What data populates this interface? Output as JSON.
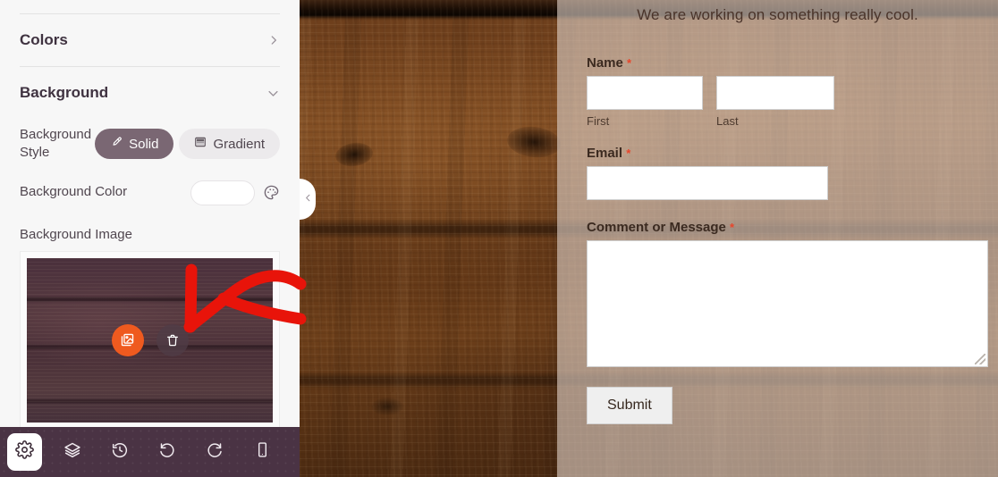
{
  "sidebar": {
    "sections": [
      {
        "title": "Colors",
        "chevron_icon": "chevron-right-icon",
        "expanded": false
      },
      {
        "title": "Background",
        "chevron_icon": "chevron-down-icon",
        "expanded": true
      }
    ],
    "background_style": {
      "label": "Background Style",
      "options": [
        {
          "label": "Solid",
          "icon": "eyedropper-icon",
          "active": true
        },
        {
          "label": "Gradient",
          "icon": "gradient-grid-icon",
          "active": false
        }
      ]
    },
    "background_color": {
      "label": "Background Color",
      "value": "#ffffff",
      "picker_icon": "palette-icon"
    },
    "background_image": {
      "label": "Background Image",
      "replace_icon": "image-swap-icon",
      "delete_icon": "trash-icon"
    },
    "collapse_handle_icon": "chevron-left-icon"
  },
  "toolbar": {
    "items": [
      {
        "name": "settings",
        "icon": "gear-icon",
        "active": true
      },
      {
        "name": "layers",
        "icon": "layers-icon",
        "active": false
      },
      {
        "name": "revisions",
        "icon": "history-clock-icon",
        "active": false
      },
      {
        "name": "undo",
        "icon": "undo-icon",
        "active": false
      },
      {
        "name": "redo",
        "icon": "redo-icon",
        "active": false
      },
      {
        "name": "mobile-preview",
        "icon": "mobile-device-icon",
        "active": false
      }
    ]
  },
  "preview": {
    "heading": "We are working on something really cool.",
    "fields": {
      "name": {
        "label": "Name",
        "required_marker": "*",
        "first": {
          "value": "",
          "sub_label": "First"
        },
        "last": {
          "value": "",
          "sub_label": "Last"
        }
      },
      "email": {
        "label": "Email",
        "required_marker": "*",
        "value": ""
      },
      "comment": {
        "label": "Comment or Message",
        "required_marker": "*",
        "value": ""
      }
    },
    "submit_label": "Submit"
  },
  "colors": {
    "accent_orange": "#ef5a1f",
    "toolbar_purple": "#4a3344",
    "toggle_active": "#7a6773",
    "annotation_red": "#e8140a",
    "required_star": "#e8452a"
  }
}
